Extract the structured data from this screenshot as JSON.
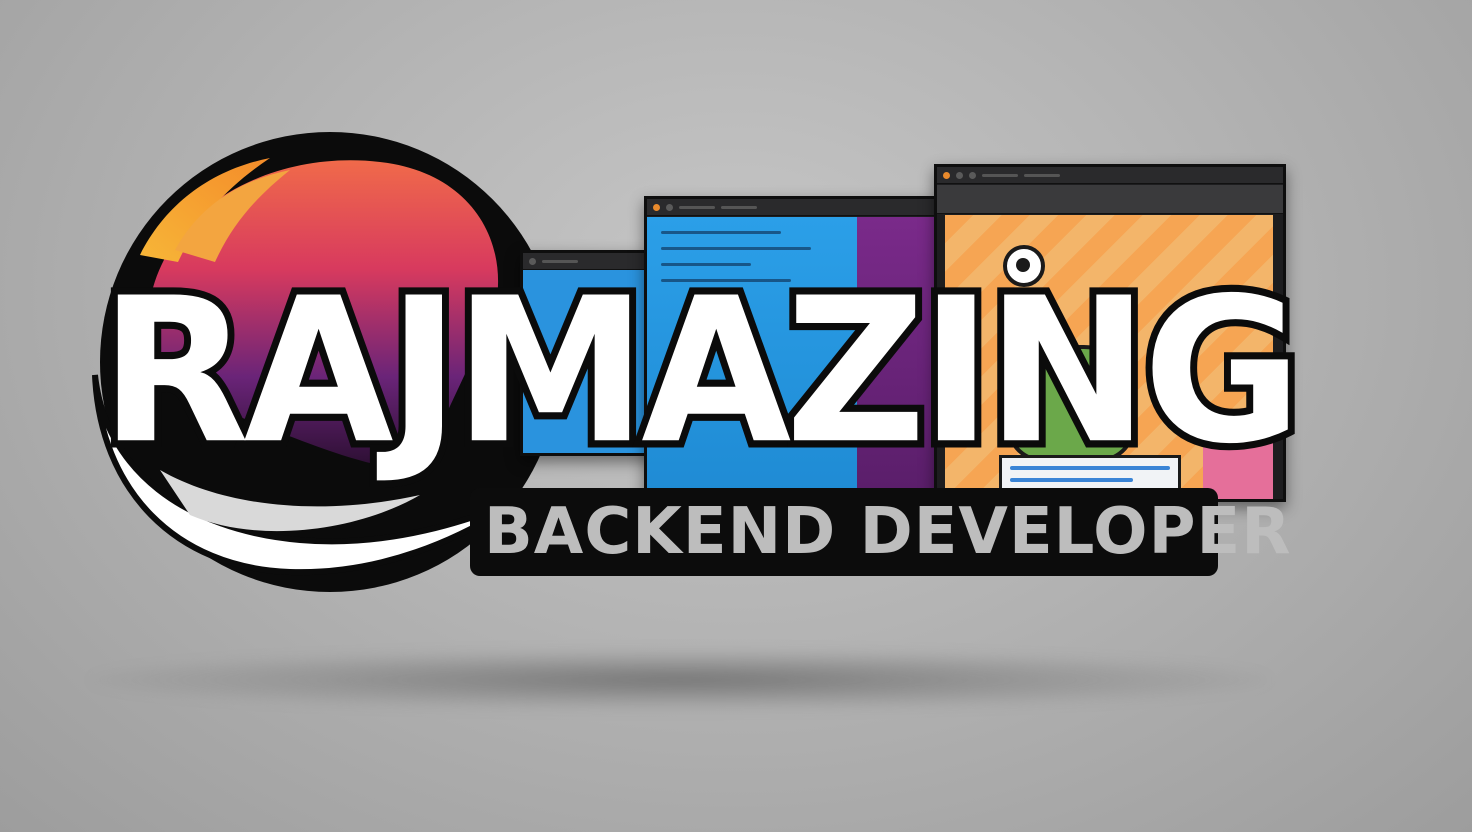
{
  "brand": {
    "name": "RAJMAZING",
    "tagline": "BACKEND DEVELOPER"
  },
  "colors": {
    "background": "#b5b5b5",
    "outline": "#0b0b0b",
    "text_primary": "#ffffff",
    "text_secondary": "#bdbdbd",
    "swirl_orange": "#f2a03a",
    "swirl_red": "#e0414d",
    "swirl_purple": "#6a2a7a",
    "screen_blue": "#2a93de",
    "screen_purple": "#6a2478",
    "screen_orange": "#f6a553"
  },
  "icons": {
    "swirl_emblem": "swirl-emblem-icon",
    "mascot": "mascot-icon"
  }
}
